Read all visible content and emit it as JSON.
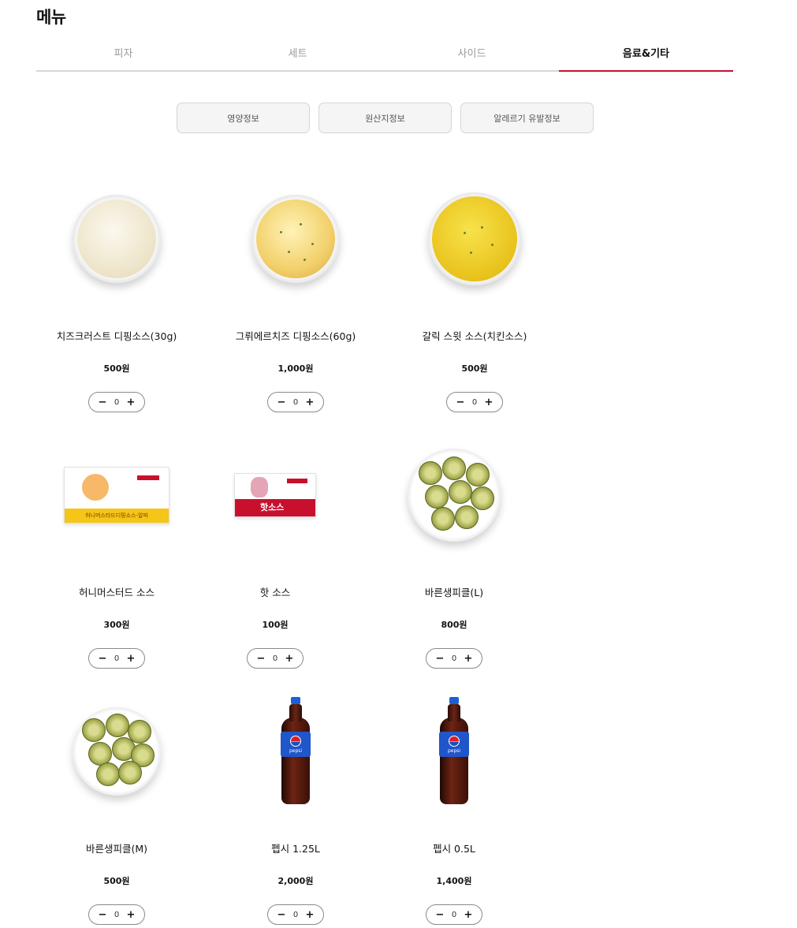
{
  "page": {
    "title": "메뉴"
  },
  "tabs": [
    {
      "label": "피자",
      "active": false
    },
    {
      "label": "세트",
      "active": false
    },
    {
      "label": "사이드",
      "active": false
    },
    {
      "label": "음료&기타",
      "active": true
    }
  ],
  "info_buttons": [
    {
      "label": "영양정보"
    },
    {
      "label": "원산지정보"
    },
    {
      "label": "알레르기 유발정보"
    }
  ],
  "stepper": {
    "minus_symbol": "−",
    "plus_symbol": "+"
  },
  "products": [
    {
      "name": "치즈크러스트 디핑소스(30g)",
      "price": "500원",
      "quantity": "0",
      "image": "cream-sauce-bowl"
    },
    {
      "name": "그뤼에르치즈 디핑소스(60g)",
      "price": "1,000원",
      "quantity": "0",
      "image": "cheese-sauce-bowl"
    },
    {
      "name": "갈릭 스윗 소스(치킨소스)",
      "price": "500원",
      "quantity": "0",
      "image": "garlic-sauce-bowl"
    },
    {
      "name": "허니머스터드 소스",
      "price": "300원",
      "quantity": "0",
      "image": "mustard-sachet",
      "package_text": "허니머스타드디핑소스-알파"
    },
    {
      "name": "핫 소스",
      "price": "100원",
      "quantity": "0",
      "image": "hot-sauce-sachet",
      "package_text": "핫소스"
    },
    {
      "name": "바른생피클(L)",
      "price": "800원",
      "quantity": "0",
      "image": "pickle-bowl"
    },
    {
      "name": "바른생피클(M)",
      "price": "500원",
      "quantity": "0",
      "image": "pickle-bowl"
    },
    {
      "name": "펩시 1.25L",
      "price": "2,000원",
      "quantity": "0",
      "image": "pepsi-bottle",
      "package_text": "pepsi"
    },
    {
      "name": "펩시 0.5L",
      "price": "1,400원",
      "quantity": "0",
      "image": "pepsi-bottle",
      "package_text": "pepsi"
    }
  ],
  "colors": {
    "accent": "#c8102e",
    "tab_inactive": "#9a9a9a",
    "button_bg": "#f5f5f5"
  }
}
